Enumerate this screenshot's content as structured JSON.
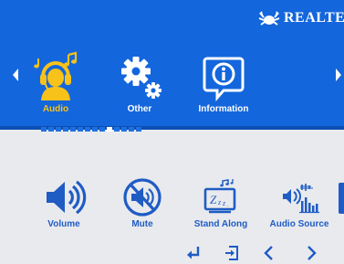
{
  "brand": {
    "logo_icon": "realtek-crab-logo-icon",
    "name": "REALTE"
  },
  "nav": {
    "left_icon": "arrow-left-icon",
    "right_icon": "arrow-right-icon"
  },
  "categories": [
    {
      "label": "Audio",
      "icon": "headphones-person-icon",
      "selected": true
    },
    {
      "label": "Other",
      "icon": "gears-icon",
      "selected": false
    },
    {
      "label": "Information",
      "icon": "info-icon",
      "selected": false
    }
  ],
  "page_indicator": {
    "total": 14,
    "active_index": 9
  },
  "submenu": [
    {
      "label": "Volume",
      "icon": "speaker-icon"
    },
    {
      "label": "Mute",
      "icon": "mute-icon"
    },
    {
      "label": "Stand Along",
      "icon": "sleep-monitor-icon"
    },
    {
      "label": "Audio Source",
      "icon": "audio-source-icon"
    }
  ],
  "controls": [
    {
      "icon": "enter-icon"
    },
    {
      "icon": "exit-icon"
    },
    {
      "icon": "chevron-left-icon"
    },
    {
      "icon": "chevron-right-icon"
    }
  ],
  "colors": {
    "top_bg": "#1466dc",
    "bottom_bg": "#e9eaee",
    "selected": "#f7c21a",
    "icon_blue": "#1f5cc4"
  }
}
